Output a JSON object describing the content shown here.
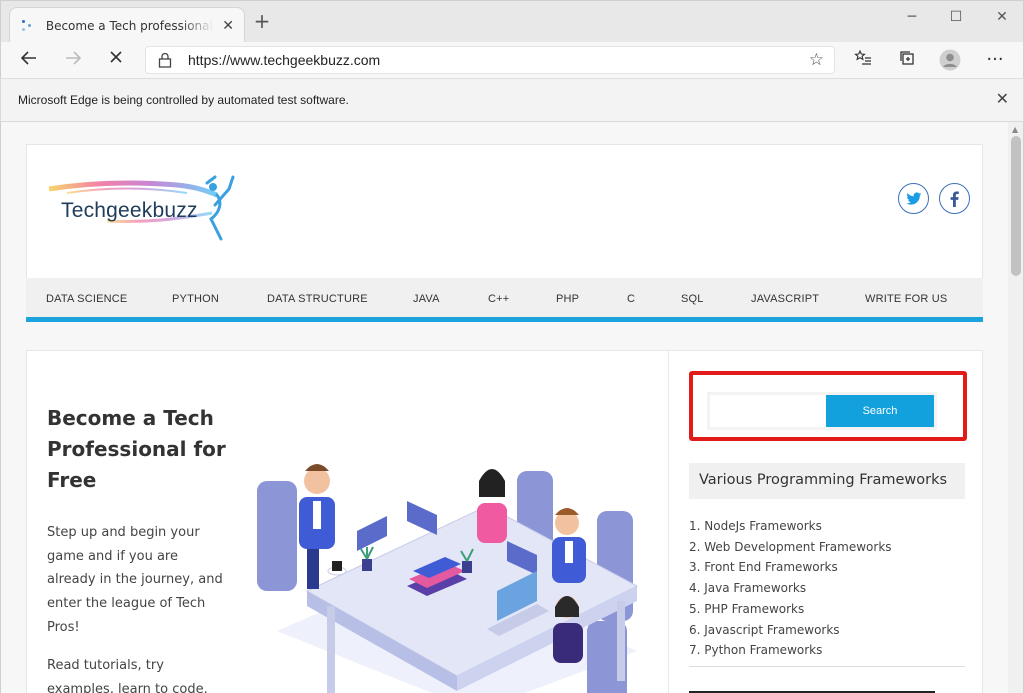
{
  "browser": {
    "tab_title": "Become a Tech professional for f",
    "url": "https://www.techgeekbuzz.com",
    "infobar_message": "Microsoft Edge is being controlled by automated test software."
  },
  "site": {
    "logo_text": "Techgeekbuzz",
    "nav": [
      "DATA SCIENCE",
      "PYTHON",
      "DATA STRUCTURE",
      "JAVA",
      "C++",
      "PHP",
      "C",
      "SQL",
      "JAVASCRIPT",
      "WRITE FOR US"
    ],
    "accent_color": "#1aa3dc"
  },
  "hero": {
    "title": "Become a Tech Professional for Free",
    "para1": "Step up and begin your game and if you are already in the journey, and enter the league of Tech Pros!",
    "para2": "Read tutorials, try examples, learn to code."
  },
  "sidebar": {
    "search_button": "Search",
    "search_placeholder": "",
    "widget_title": "Various Programming Frameworks",
    "frameworks": [
      "1. NodeJs Frameworks",
      "2. Web Development Frameworks",
      "3. Front End Frameworks",
      "4. Java Frameworks",
      "5. PHP Frameworks",
      "6. Javascript Frameworks",
      "7. Python Frameworks"
    ]
  }
}
